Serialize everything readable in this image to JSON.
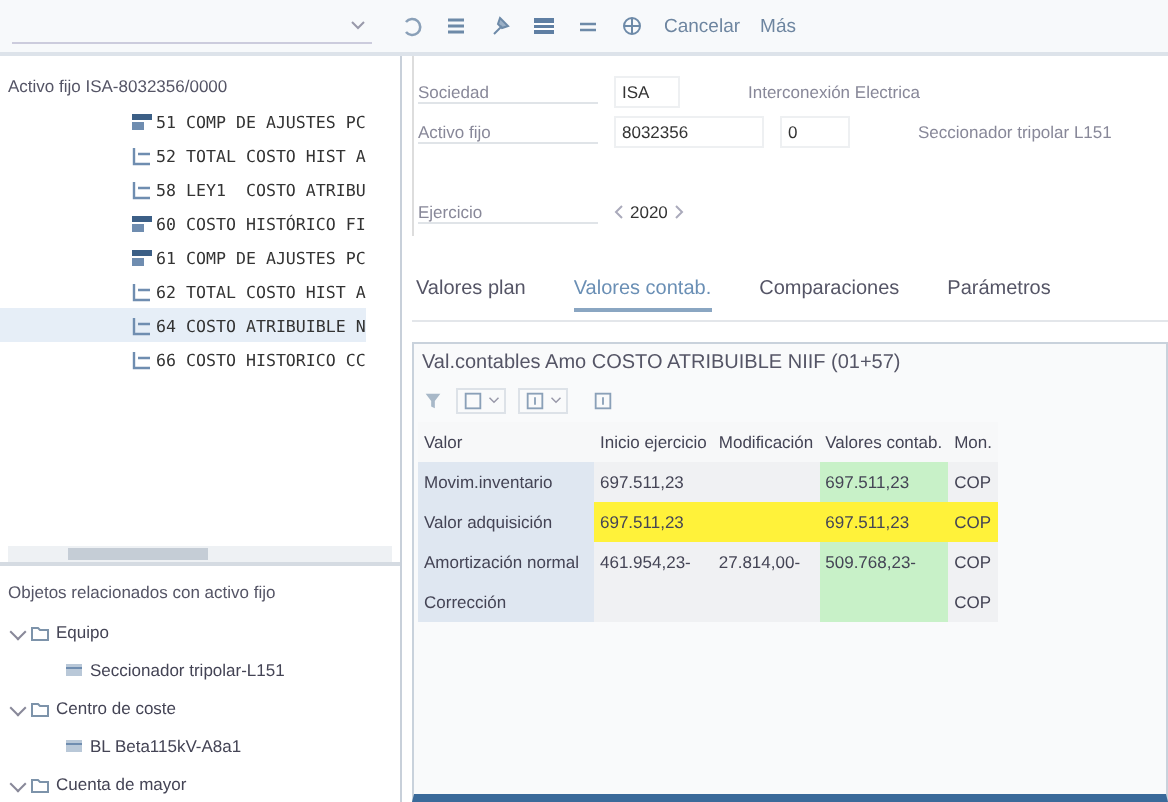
{
  "toolbar": {
    "actions": [
      "Cancelar",
      "Más"
    ]
  },
  "asset_tree": {
    "title": "Activo fijo ISA-8032356/0000",
    "items": [
      {
        "code": "51",
        "text": "COMP DE AJUSTES PC",
        "kind": "summary",
        "selected": false
      },
      {
        "code": "52",
        "text": "TOTAL COSTO HIST A",
        "kind": "total",
        "selected": false
      },
      {
        "code": "58",
        "text": "LEY1  COSTO ATRIBU",
        "kind": "total",
        "selected": false
      },
      {
        "code": "60",
        "text": "COSTO HISTÓRICO FI",
        "kind": "summary",
        "selected": false
      },
      {
        "code": "61",
        "text": "COMP DE AJUSTES PC",
        "kind": "summary",
        "selected": false
      },
      {
        "code": "62",
        "text": "TOTAL COSTO HIST A",
        "kind": "total",
        "selected": false
      },
      {
        "code": "64",
        "text": "COSTO ATRIBUIBLE N",
        "kind": "total",
        "selected": true
      },
      {
        "code": "66",
        "text": "COSTO HISTORICO CC",
        "kind": "total",
        "selected": false
      }
    ]
  },
  "related": {
    "title": "Objetos relacionados con activo fijo",
    "items": [
      {
        "label": "Equipo",
        "expanded": true,
        "children": [
          {
            "label": "Seccionador tripolar-L151"
          }
        ]
      },
      {
        "label": "Centro de coste",
        "expanded": true,
        "children": [
          {
            "label": "BL Beta115kV-A8a1"
          }
        ]
      },
      {
        "label": "Cuenta de mayor",
        "expanded": true
      }
    ]
  },
  "form": {
    "company_label": "Sociedad",
    "company": "ISA",
    "company_name": "Interconexión Electrica",
    "asset_label": "Activo fijo",
    "asset": "8032356",
    "sub_number": "0",
    "asset_name": "Seccionador tripolar L151",
    "year_label": "Ejercicio",
    "year": "2020"
  },
  "tabs": [
    {
      "label": "Valores plan",
      "selected": false
    },
    {
      "label": "Valores contab.",
      "selected": true
    },
    {
      "label": "Comparaciones",
      "selected": false
    },
    {
      "label": "Parámetros",
      "selected": false
    }
  ],
  "table": {
    "title": "Val.contables Amo COSTO ATRIBUIBLE NIIF (01+57)",
    "columns": [
      "Valor",
      "Inicio ejercicio",
      "Modificación",
      "Valores contab.",
      "Mon."
    ],
    "rows": [
      {
        "cells": [
          "Movim.inventario",
          "697.511,23",
          "",
          "697.511,23",
          "COP"
        ],
        "selected": false
      },
      {
        "cells": [
          "Valor adquisición",
          "697.511,23",
          "",
          "697.511,23",
          "COP"
        ],
        "selected": true
      },
      {
        "cells": [
          "Amortización normal",
          "461.954,23-",
          "27.814,00-",
          "509.768,23-",
          "COP"
        ],
        "selected": false
      },
      {
        "cells": [
          "Corrección",
          "",
          "",
          "",
          "COP"
        ],
        "selected": false
      }
    ]
  }
}
